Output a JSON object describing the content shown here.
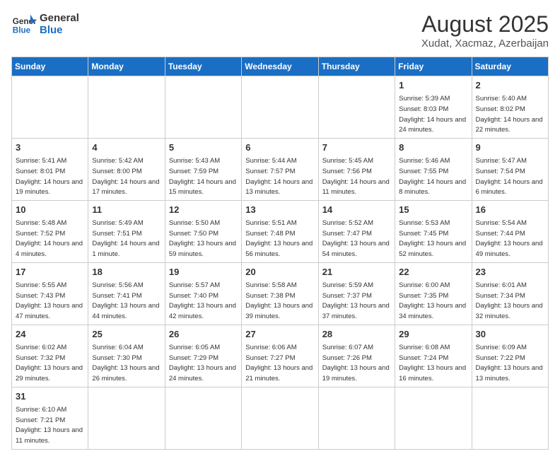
{
  "header": {
    "logo_general": "General",
    "logo_blue": "Blue",
    "month_title": "August 2025",
    "location": "Xudat, Xacmaz, Azerbaijan"
  },
  "weekdays": [
    "Sunday",
    "Monday",
    "Tuesday",
    "Wednesday",
    "Thursday",
    "Friday",
    "Saturday"
  ],
  "days": {
    "1": {
      "sunrise": "5:39 AM",
      "sunset": "8:03 PM",
      "daylight": "14 hours and 24 minutes."
    },
    "2": {
      "sunrise": "5:40 AM",
      "sunset": "8:02 PM",
      "daylight": "14 hours and 22 minutes."
    },
    "3": {
      "sunrise": "5:41 AM",
      "sunset": "8:01 PM",
      "daylight": "14 hours and 19 minutes."
    },
    "4": {
      "sunrise": "5:42 AM",
      "sunset": "8:00 PM",
      "daylight": "14 hours and 17 minutes."
    },
    "5": {
      "sunrise": "5:43 AM",
      "sunset": "7:59 PM",
      "daylight": "14 hours and 15 minutes."
    },
    "6": {
      "sunrise": "5:44 AM",
      "sunset": "7:57 PM",
      "daylight": "14 hours and 13 minutes."
    },
    "7": {
      "sunrise": "5:45 AM",
      "sunset": "7:56 PM",
      "daylight": "14 hours and 11 minutes."
    },
    "8": {
      "sunrise": "5:46 AM",
      "sunset": "7:55 PM",
      "daylight": "14 hours and 8 minutes."
    },
    "9": {
      "sunrise": "5:47 AM",
      "sunset": "7:54 PM",
      "daylight": "14 hours and 6 minutes."
    },
    "10": {
      "sunrise": "5:48 AM",
      "sunset": "7:52 PM",
      "daylight": "14 hours and 4 minutes."
    },
    "11": {
      "sunrise": "5:49 AM",
      "sunset": "7:51 PM",
      "daylight": "14 hours and 1 minute."
    },
    "12": {
      "sunrise": "5:50 AM",
      "sunset": "7:50 PM",
      "daylight": "13 hours and 59 minutes."
    },
    "13": {
      "sunrise": "5:51 AM",
      "sunset": "7:48 PM",
      "daylight": "13 hours and 56 minutes."
    },
    "14": {
      "sunrise": "5:52 AM",
      "sunset": "7:47 PM",
      "daylight": "13 hours and 54 minutes."
    },
    "15": {
      "sunrise": "5:53 AM",
      "sunset": "7:45 PM",
      "daylight": "13 hours and 52 minutes."
    },
    "16": {
      "sunrise": "5:54 AM",
      "sunset": "7:44 PM",
      "daylight": "13 hours and 49 minutes."
    },
    "17": {
      "sunrise": "5:55 AM",
      "sunset": "7:43 PM",
      "daylight": "13 hours and 47 minutes."
    },
    "18": {
      "sunrise": "5:56 AM",
      "sunset": "7:41 PM",
      "daylight": "13 hours and 44 minutes."
    },
    "19": {
      "sunrise": "5:57 AM",
      "sunset": "7:40 PM",
      "daylight": "13 hours and 42 minutes."
    },
    "20": {
      "sunrise": "5:58 AM",
      "sunset": "7:38 PM",
      "daylight": "13 hours and 39 minutes."
    },
    "21": {
      "sunrise": "5:59 AM",
      "sunset": "7:37 PM",
      "daylight": "13 hours and 37 minutes."
    },
    "22": {
      "sunrise": "6:00 AM",
      "sunset": "7:35 PM",
      "daylight": "13 hours and 34 minutes."
    },
    "23": {
      "sunrise": "6:01 AM",
      "sunset": "7:34 PM",
      "daylight": "13 hours and 32 minutes."
    },
    "24": {
      "sunrise": "6:02 AM",
      "sunset": "7:32 PM",
      "daylight": "13 hours and 29 minutes."
    },
    "25": {
      "sunrise": "6:04 AM",
      "sunset": "7:30 PM",
      "daylight": "13 hours and 26 minutes."
    },
    "26": {
      "sunrise": "6:05 AM",
      "sunset": "7:29 PM",
      "daylight": "13 hours and 24 minutes."
    },
    "27": {
      "sunrise": "6:06 AM",
      "sunset": "7:27 PM",
      "daylight": "13 hours and 21 minutes."
    },
    "28": {
      "sunrise": "6:07 AM",
      "sunset": "7:26 PM",
      "daylight": "13 hours and 19 minutes."
    },
    "29": {
      "sunrise": "6:08 AM",
      "sunset": "7:24 PM",
      "daylight": "13 hours and 16 minutes."
    },
    "30": {
      "sunrise": "6:09 AM",
      "sunset": "7:22 PM",
      "daylight": "13 hours and 13 minutes."
    },
    "31": {
      "sunrise": "6:10 AM",
      "sunset": "7:21 PM",
      "daylight": "13 hours and 11 minutes."
    }
  }
}
